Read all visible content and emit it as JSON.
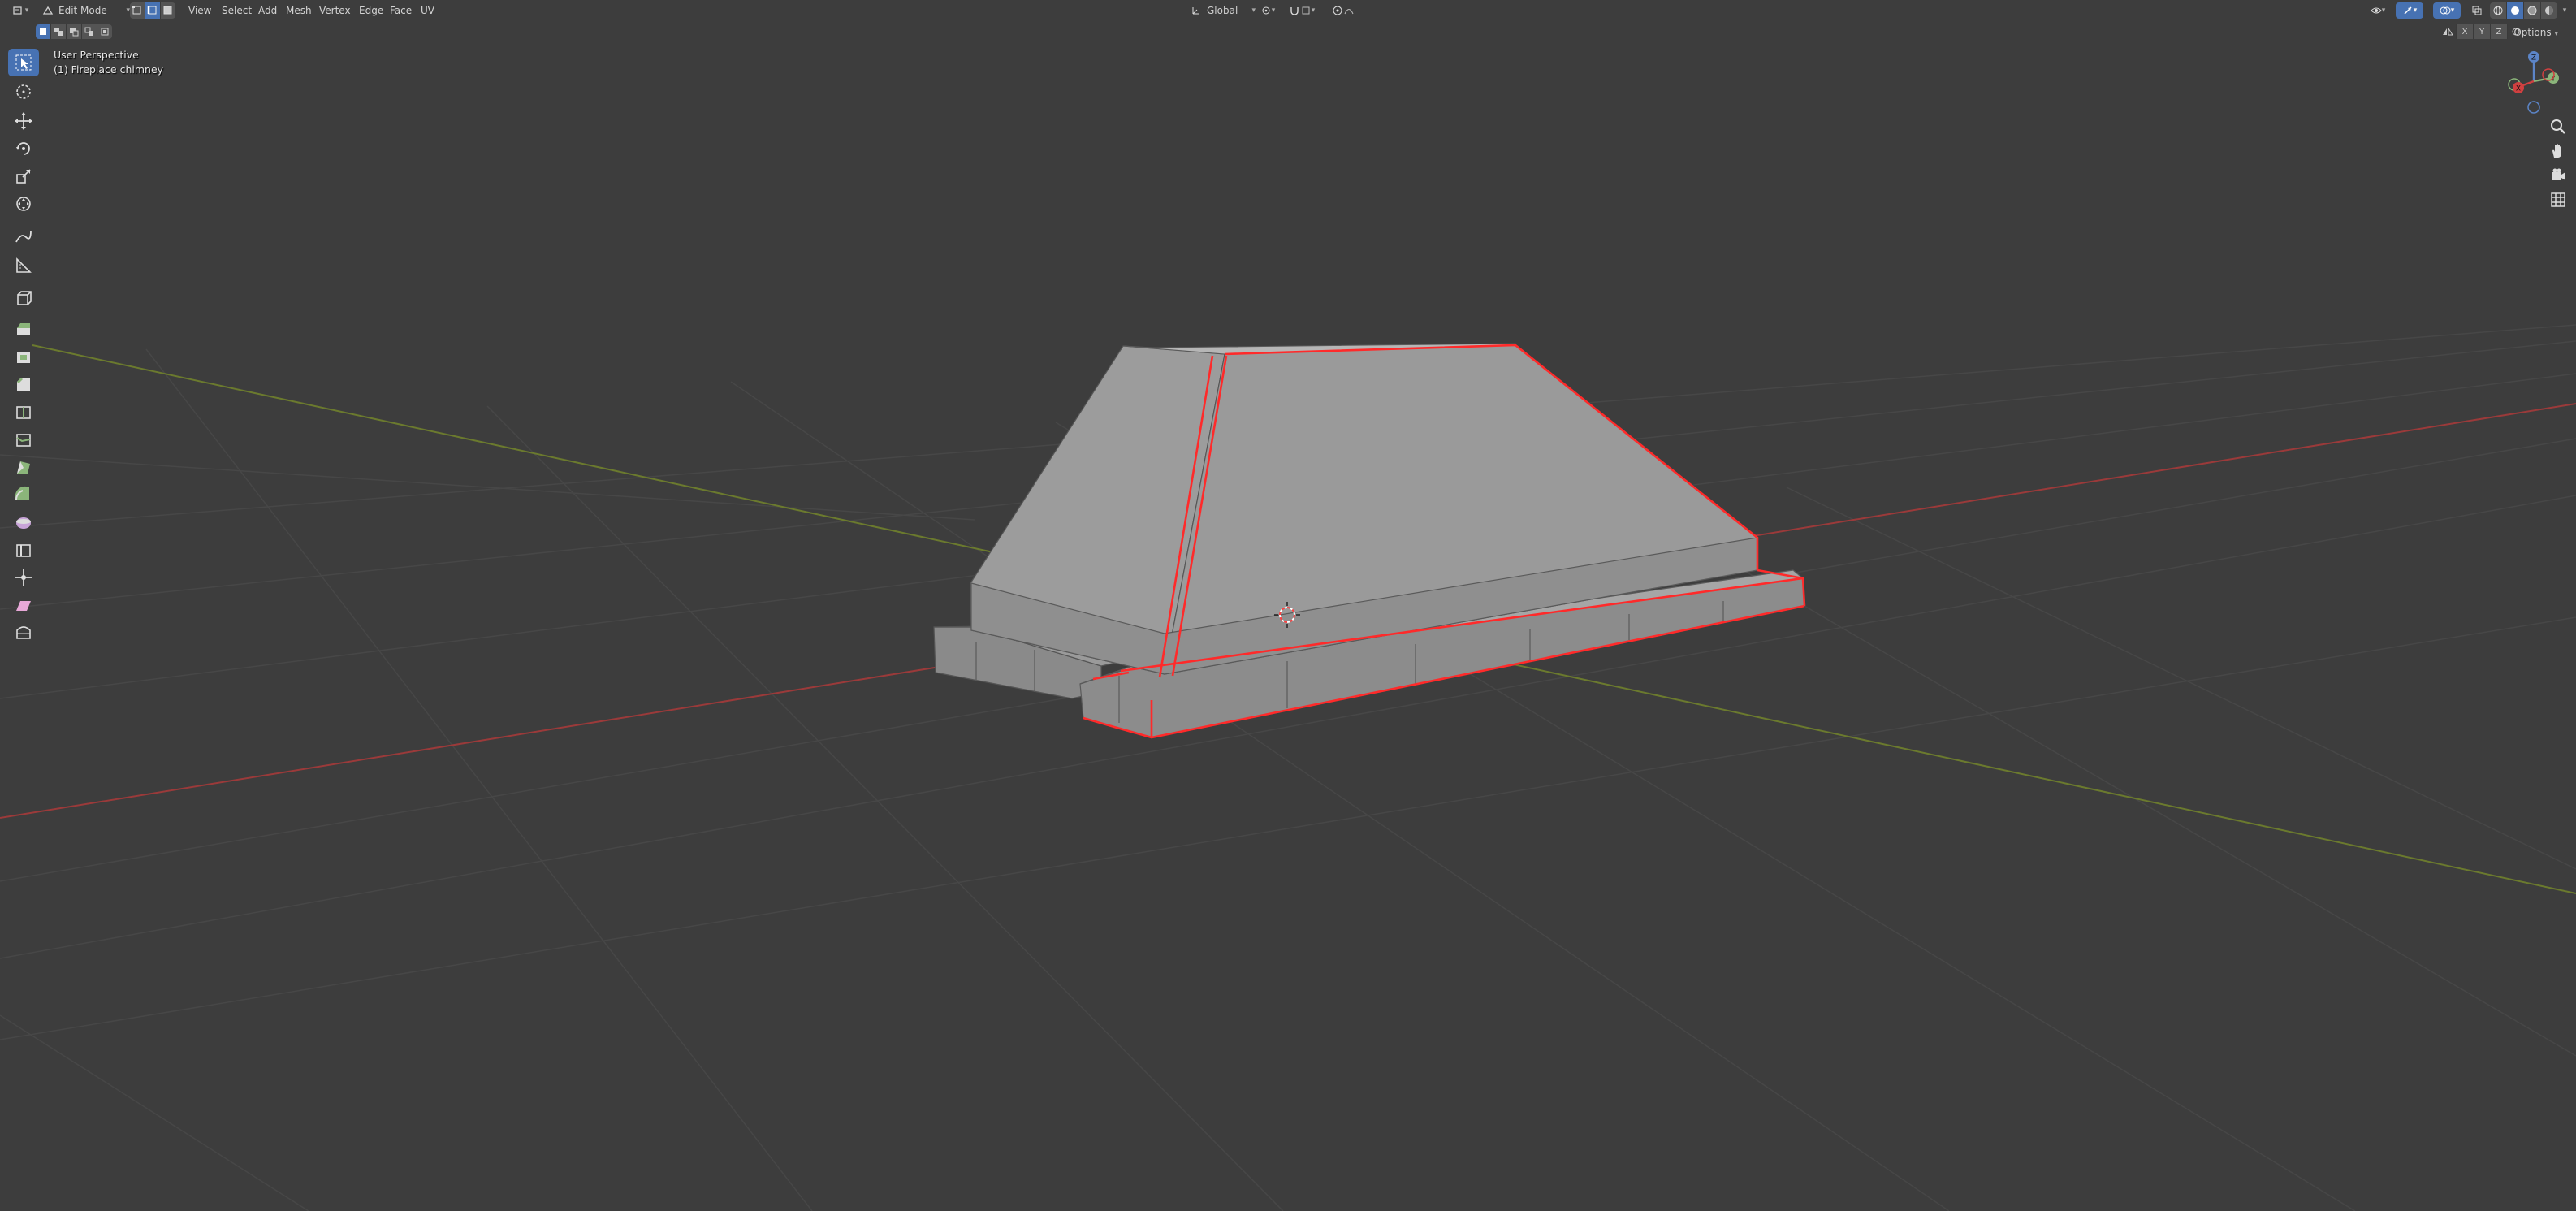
{
  "header": {
    "mode_dropdown": {
      "label": "Edit Mode",
      "icon": "edit-mode-icon"
    },
    "select_mode_buttons": [
      {
        "icon": "vertex-select-icon",
        "active": false
      },
      {
        "icon": "edge-select-icon",
        "active": true
      },
      {
        "icon": "face-select-icon",
        "active": false
      }
    ],
    "menus": [
      "View",
      "Select",
      "Add",
      "Mesh",
      "Vertex",
      "Edge",
      "Face",
      "UV"
    ],
    "transform_orientation": {
      "label": "Global",
      "icon": "global-orientation-icon"
    },
    "pivot_icon": "pivot-point-icon",
    "snap_icon": "snap-icon",
    "proportional_icon": "proportional-editing-icon",
    "right_icons": [
      "visibility-icon",
      "gizmo-icon",
      "overlay-icon",
      "xray-icon",
      "shading-wireframe-icon",
      "shading-solid-icon",
      "shading-material-icon",
      "shading-rendered-icon"
    ],
    "mirror_axes": [
      "X",
      "Y",
      "Z"
    ],
    "options_label": "Options"
  },
  "viewport": {
    "perspective_label": "User Perspective",
    "object_label": "(1) Fireplace chimney",
    "colors": {
      "background": "#3d3d3d",
      "grid": "#484848",
      "x_axis": "#9b3a3a",
      "y_axis": "#6b7a2e",
      "mesh_face": "#8d8d8d",
      "mesh_edge_selected": "#ff2a2a"
    }
  },
  "toolbar": {
    "tools": [
      {
        "icon": "select-box-icon",
        "active": true
      },
      {
        "icon": "cursor-icon",
        "active": false
      },
      {
        "icon": "move-icon",
        "active": false
      },
      {
        "icon": "rotate-icon",
        "active": false
      },
      {
        "icon": "scale-icon",
        "active": false
      },
      {
        "icon": "transform-icon",
        "active": false
      },
      {
        "icon": "annotate-icon",
        "active": false
      },
      {
        "icon": "measure-icon",
        "active": false
      },
      {
        "icon": "add-cube-icon",
        "active": false
      },
      {
        "icon": "extrude-region-icon",
        "active": false
      },
      {
        "icon": "inset-faces-icon",
        "active": false
      },
      {
        "icon": "bevel-icon",
        "active": false
      },
      {
        "icon": "loop-cut-icon",
        "active": false
      },
      {
        "icon": "knife-icon",
        "active": false
      },
      {
        "icon": "poly-build-icon",
        "active": false
      },
      {
        "icon": "spin-icon",
        "active": false
      },
      {
        "icon": "smooth-icon",
        "active": false
      },
      {
        "icon": "edge-slide-icon",
        "active": false
      },
      {
        "icon": "shrink-fatten-icon",
        "active": false
      },
      {
        "icon": "shear-icon",
        "active": false
      },
      {
        "icon": "rip-region-icon",
        "active": false
      }
    ]
  },
  "navigation": {
    "gizmo_axes": [
      "Z",
      "Y",
      "X"
    ],
    "buttons": [
      "zoom-icon",
      "pan-hand-icon",
      "camera-view-icon",
      "orthographic-grid-icon"
    ]
  }
}
